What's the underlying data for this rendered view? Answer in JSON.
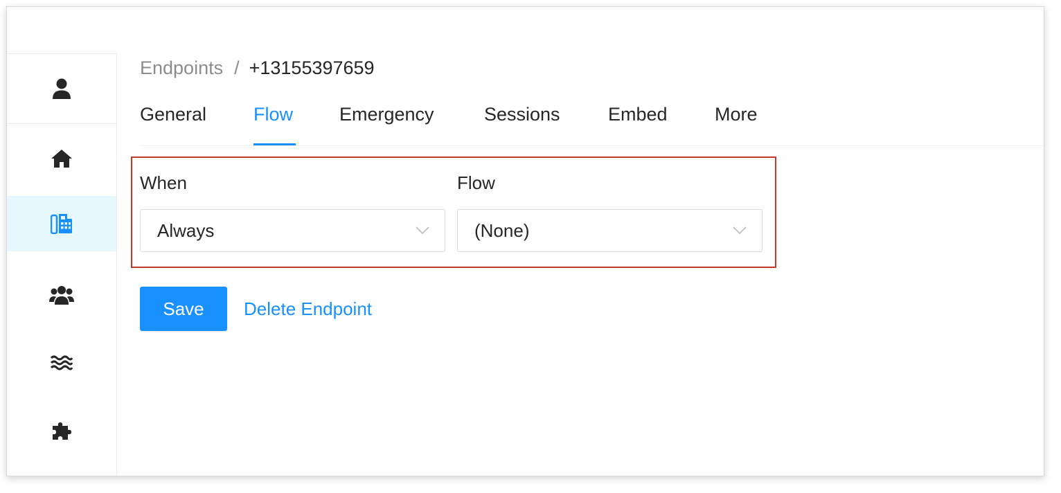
{
  "sidebar": {
    "items": [
      {
        "icon": "user-icon",
        "active": false
      },
      {
        "icon": "home-icon",
        "active": false
      },
      {
        "icon": "phone-fax-icon",
        "active": true
      },
      {
        "icon": "users-group-icon",
        "active": false
      },
      {
        "icon": "water-waves-icon",
        "active": false
      },
      {
        "icon": "puzzle-piece-icon",
        "active": false
      }
    ]
  },
  "breadcrumb": {
    "parent": "Endpoints",
    "separator": "/",
    "current": "+13155397659"
  },
  "tabs": [
    {
      "label": "General",
      "active": false
    },
    {
      "label": "Flow",
      "active": true
    },
    {
      "label": "Emergency",
      "active": false
    },
    {
      "label": "Sessions",
      "active": false
    },
    {
      "label": "Embed",
      "active": false
    },
    {
      "label": "More",
      "active": false
    }
  ],
  "form": {
    "when": {
      "label": "When",
      "value": "Always"
    },
    "flow": {
      "label": "Flow",
      "value": "(None)"
    }
  },
  "actions": {
    "save_label": "Save",
    "delete_label": "Delete Endpoint"
  },
  "colors": {
    "accent": "#1890ff",
    "active_bg": "#e6f7ff",
    "highlight_border": "#c0392b",
    "text": "#262626",
    "muted": "#8c8c8c"
  }
}
